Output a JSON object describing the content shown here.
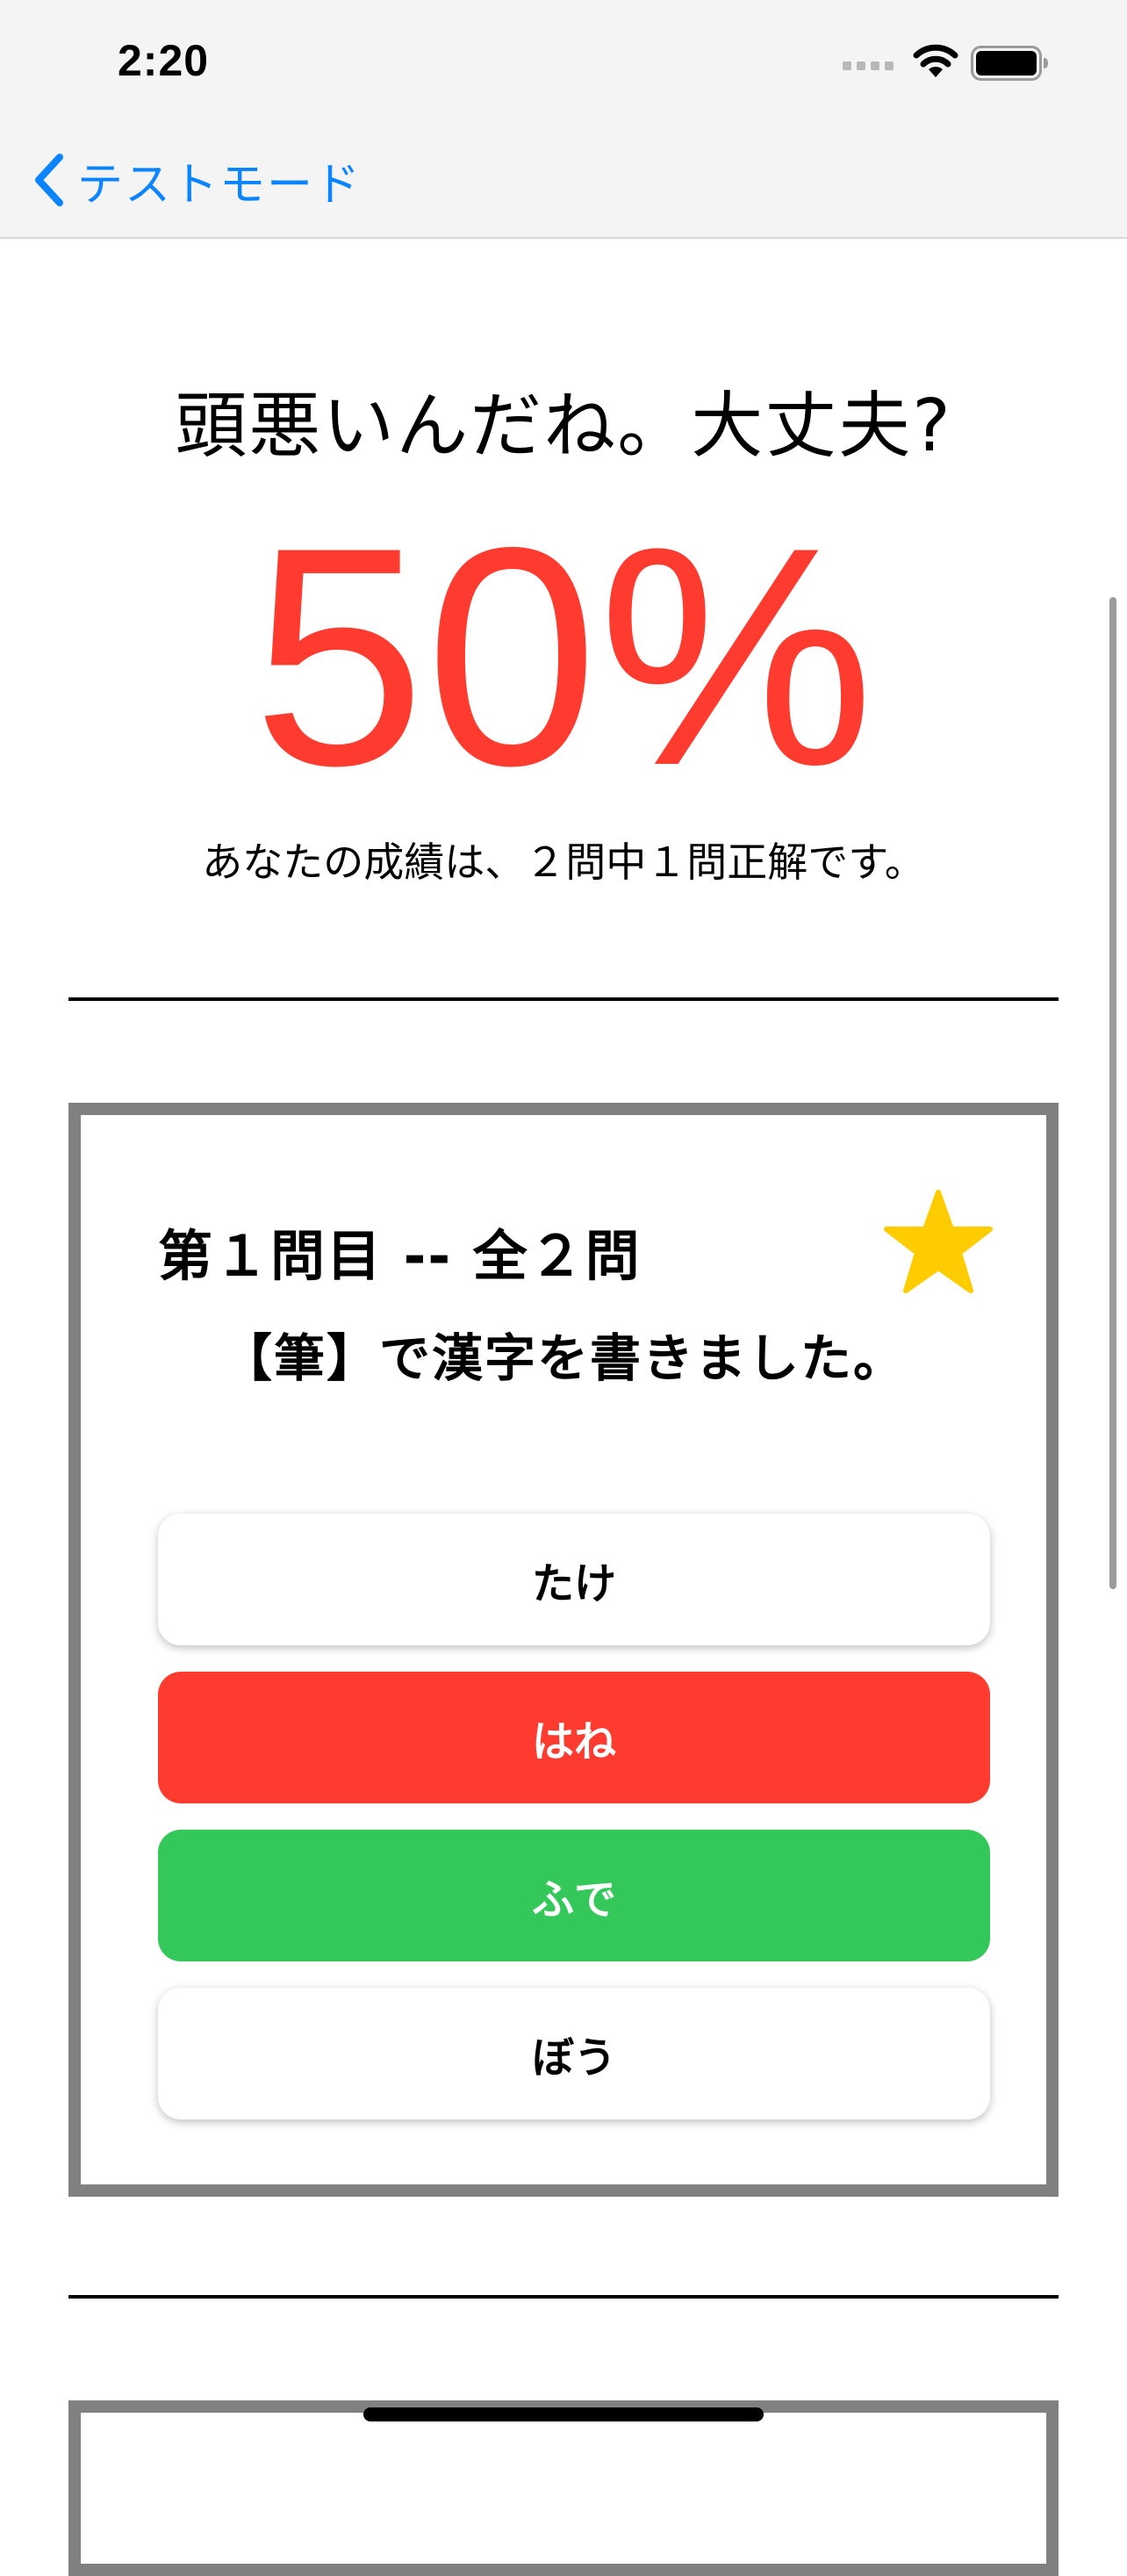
{
  "status_bar": {
    "time": "2:20",
    "icons": [
      "cellular-signal-icon",
      "wifi-icon",
      "battery-icon"
    ]
  },
  "nav": {
    "back_label": "テストモード",
    "back_icon": "chevron-left-icon",
    "accent_color": "#0a84ff"
  },
  "result": {
    "comment": "頭悪いんだね。大丈夫?",
    "score": "50%",
    "score_color": "#ff3b30",
    "summary": "あなたの成績は、２問中１問正解です。"
  },
  "question_card": {
    "number_label": "第１問目 -- 全２問",
    "favorite_icon": "star-icon",
    "favorite_color": "#ffcc00",
    "question": "【筆】で漢字を書きました。",
    "choices": [
      {
        "label": "たけ",
        "state": "neutral"
      },
      {
        "label": "はね",
        "state": "wrong"
      },
      {
        "label": "ふで",
        "state": "correct"
      },
      {
        "label": "ぼう",
        "state": "neutral"
      }
    ],
    "state_colors": {
      "wrong": "#ff3b30",
      "correct": "#34c759",
      "neutral": "#ffffff"
    }
  }
}
